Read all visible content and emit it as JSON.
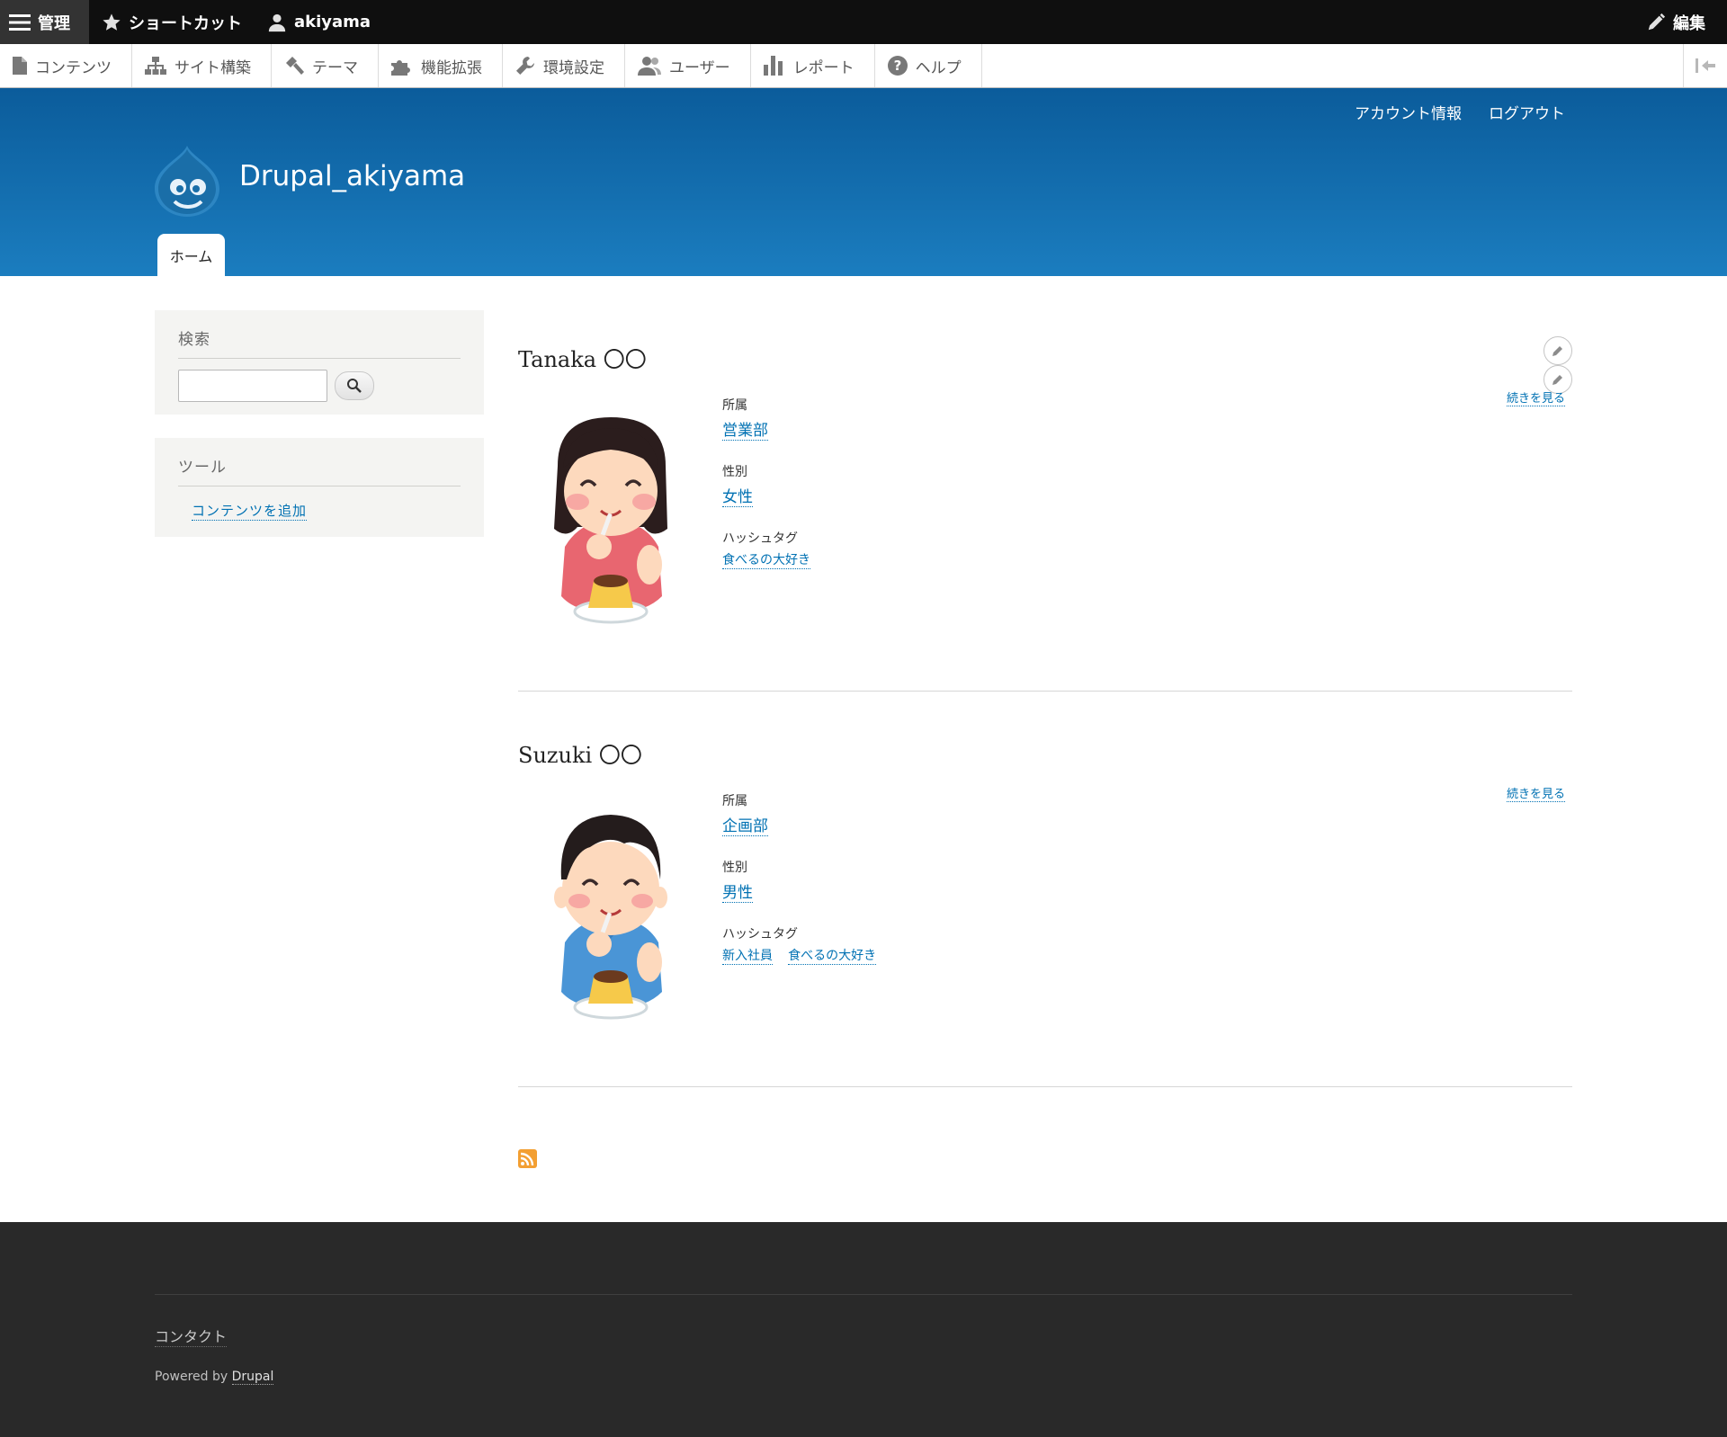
{
  "toolbar": {
    "manage": "管理",
    "shortcuts": "ショートカット",
    "user": "akiyama",
    "edit": "編集"
  },
  "tray": {
    "items": [
      {
        "label": "コンテンツ",
        "icon": "file-icon"
      },
      {
        "label": "サイト構築",
        "icon": "sitemap-icon"
      },
      {
        "label": "テーマ",
        "icon": "paintbrush-icon"
      },
      {
        "label": "機能拡張",
        "icon": "puzzle-icon"
      },
      {
        "label": "環境設定",
        "icon": "wrench-icon"
      },
      {
        "label": "ユーザー",
        "icon": "people-icon"
      },
      {
        "label": "レポート",
        "icon": "bar-chart-icon"
      },
      {
        "label": "ヘルプ",
        "icon": "help-icon"
      }
    ]
  },
  "header": {
    "account": "アカウント情報",
    "logout": "ログアウト",
    "site_name": "Drupal_akiyama",
    "tab_home": "ホーム"
  },
  "sidebar": {
    "search_title": "検索",
    "tools_title": "ツール",
    "add_content": "コンテンツを追加"
  },
  "articles": [
    {
      "title": "Tanaka 〇〇",
      "read_more": "続きを見る",
      "dept_label": "所属",
      "dept": "営業部",
      "gender_label": "性別",
      "gender": "女性",
      "tags_label": "ハッシュタグ",
      "tags": [
        "食べるの大好き"
      ]
    },
    {
      "title": "Suzuki 〇〇",
      "read_more": "続きを見る",
      "dept_label": "所属",
      "dept": "企画部",
      "gender_label": "性別",
      "gender": "男性",
      "tags_label": "ハッシュタグ",
      "tags": [
        "新入社員",
        "食べるの大好き"
      ]
    }
  ],
  "footer": {
    "contact": "コンタクト",
    "powered_prefix": "Powered by",
    "powered_link": "Drupal"
  },
  "colors": {
    "toolbar_bg": "#0f0f0f",
    "header_top": "#0b5c9b",
    "header_bottom": "#1b7dbf",
    "link": "#0071b3",
    "footer_bg": "#292929"
  }
}
